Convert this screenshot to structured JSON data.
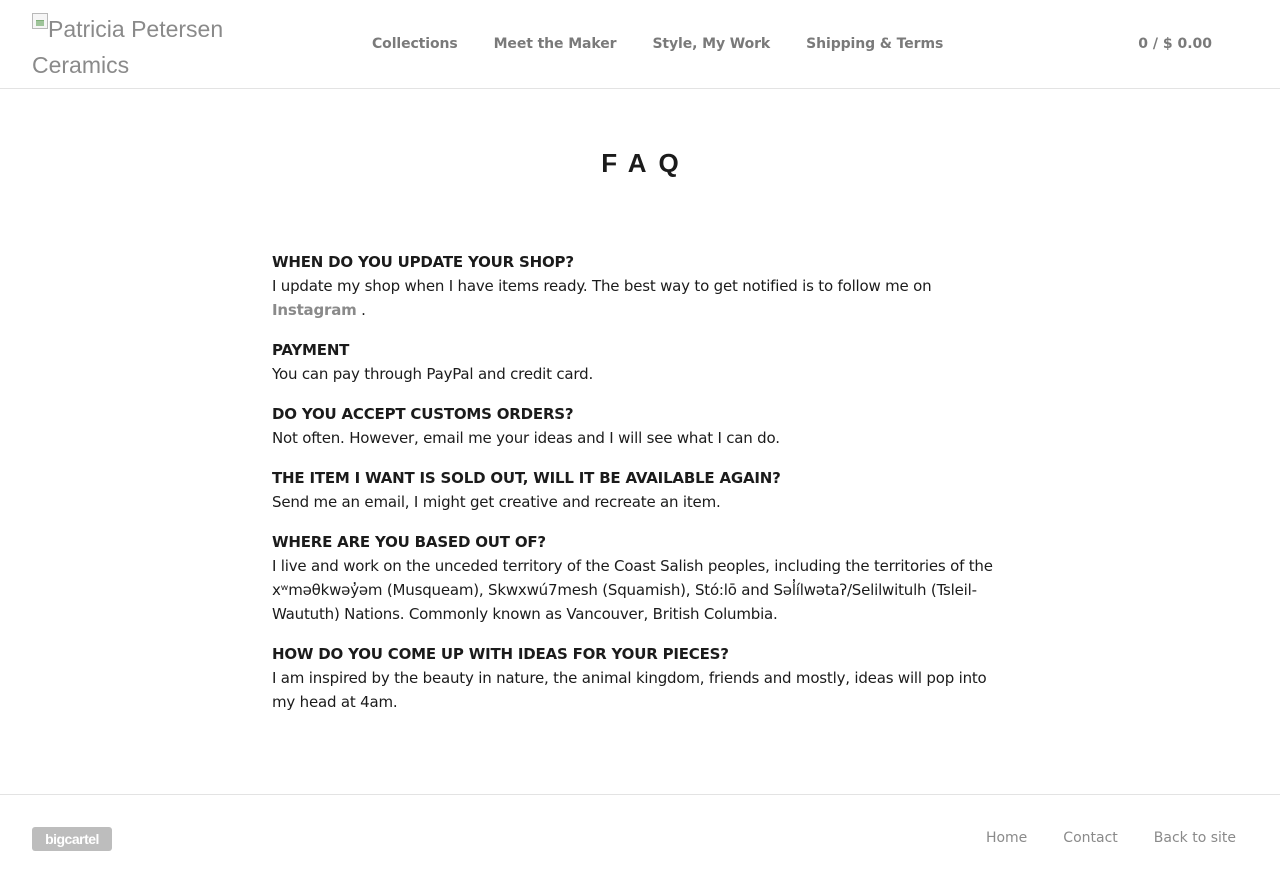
{
  "header": {
    "logo_alt": "Patricia Petersen Ceramics",
    "nav": [
      {
        "label": "Collections"
      },
      {
        "label": "Meet the Maker"
      },
      {
        "label": "Style, My Work"
      },
      {
        "label": "Shipping & Terms"
      }
    ],
    "cart": "0 / $ 0.00"
  },
  "page": {
    "title": "FAQ"
  },
  "faq": [
    {
      "question": "WHEN DO YOU UPDATE YOUR SHOP?",
      "answer_before": "I update my shop when I have items ready. The best way to get notified is to follow me on ",
      "answer_link": "Instagram",
      "answer_after": " ."
    },
    {
      "question": "PAYMENT",
      "answer": "You can pay through PayPal and credit card."
    },
    {
      "question": "DO YOU ACCEPT CUSTOMS ORDERS?",
      "answer": "Not often. However, email me your ideas and I will see what I can do."
    },
    {
      "question": "THE ITEM I WANT IS SOLD OUT, WILL IT BE AVAILABLE AGAIN?",
      "answer": "Send me an email, I might get creative and recreate an item."
    },
    {
      "question": "WHERE ARE YOU BASED OUT OF?",
      "answer": "I live and work on the unceded territory of the Coast Salish peoples, including the territories of the xʷməθkwəy̓əm (Musqueam), Skwxwú7mesh (Squamish), Stó:lō and Səl̓ílwətaʔ/Selilwitulh (Tsleil-Waututh) Nations. Commonly known as Vancouver, British Columbia."
    },
    {
      "question": "HOW DO YOU COME UP WITH IDEAS FOR YOUR PIECES?",
      "answer": "I am inspired by the beauty in nature, the animal kingdom, friends and mostly, ideas will pop into my head at 4am."
    }
  ],
  "footer": {
    "badge": "bigcartel",
    "links": [
      {
        "label": "Home"
      },
      {
        "label": "Contact"
      },
      {
        "label": "Back to site"
      }
    ]
  }
}
